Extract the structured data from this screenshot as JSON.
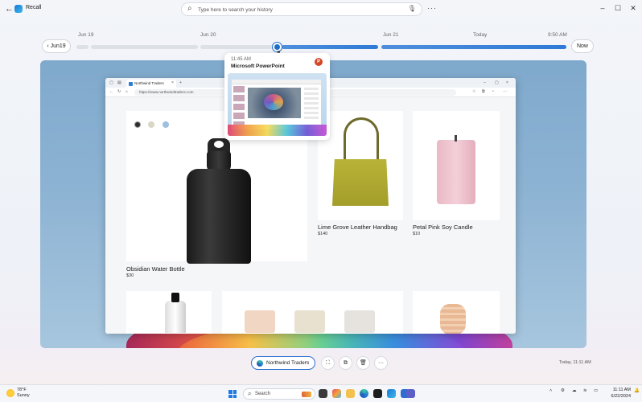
{
  "app": {
    "title": "Recall"
  },
  "search": {
    "placeholder": "Type here to search your history"
  },
  "window_controls": {
    "minimize": "–",
    "maximize": "☐",
    "close": "✕"
  },
  "timeline": {
    "back_label": "Jun19",
    "now_label": "Now",
    "markers": [
      "Jun 19",
      "Jun 20",
      "Jun 21",
      "Today",
      "9:50 AM"
    ],
    "selected_position": 0.5
  },
  "popup": {
    "time": "11:45 AM",
    "app_name": "Microsoft PowerPoint",
    "app_icon": "powerpoint-icon"
  },
  "browser": {
    "tab_title": "Northwind Traders",
    "url": "https://www.northwindtraders.com"
  },
  "products": [
    {
      "name": "Obsidian  Water Bottle",
      "price": "$30",
      "colors": [
        "#2e2e2e",
        "#d9d6c4",
        "#9dbfe0"
      ]
    },
    {
      "name": "Lime Grove Leather Handbag",
      "price": "$140"
    },
    {
      "name": "Petal Pink Soy Candle",
      "price": "$10"
    }
  ],
  "bottom_bar": {
    "app_pill_label": "Northwind Traders",
    "snapshot_time": "Today, 11:11 AM",
    "actions": [
      "screenshot-icon",
      "copy-icon",
      "delete-icon",
      "more-icon"
    ]
  },
  "taskbar": {
    "weather_temp": "78°F",
    "weather_desc": "Sunny",
    "search_label": "Search",
    "time": "11:11 AM",
    "date": "6/22/2024"
  }
}
